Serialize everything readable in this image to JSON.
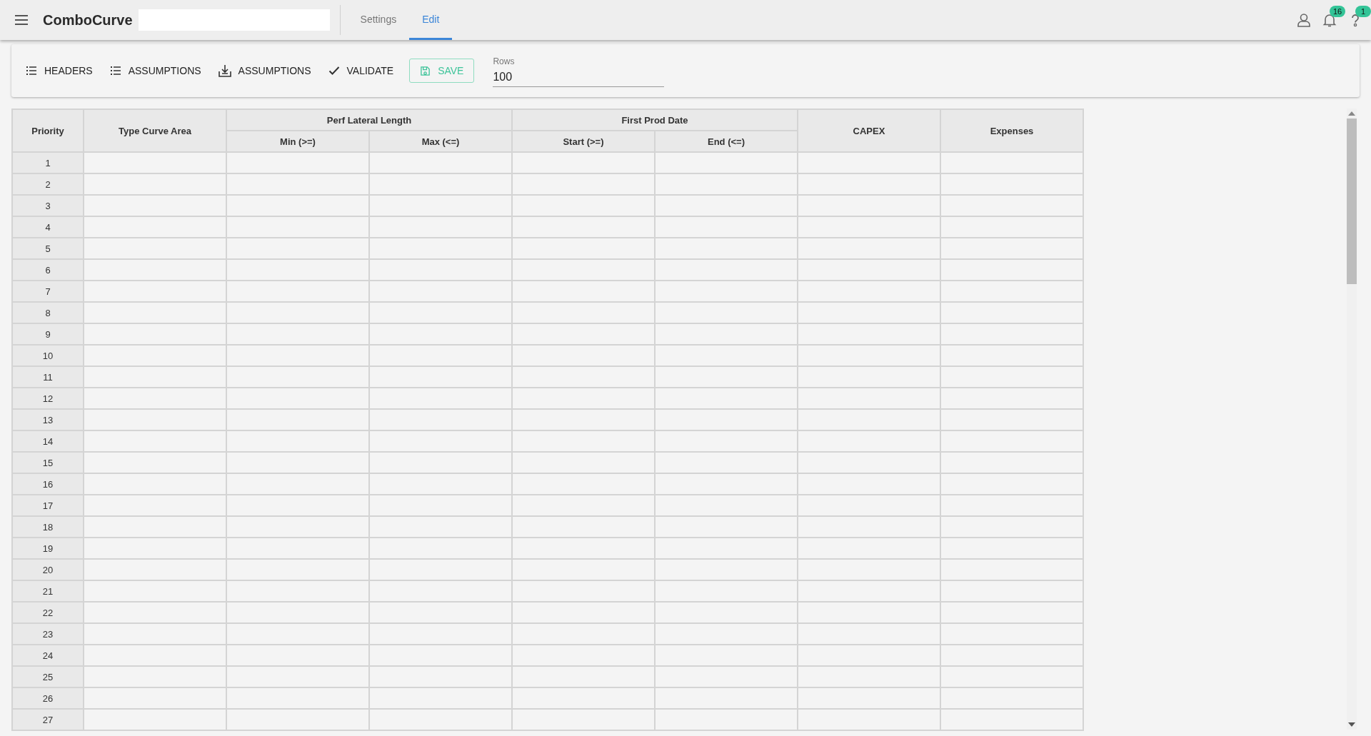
{
  "app": {
    "title": "ComboCurve"
  },
  "tabs": [
    {
      "label": "Settings",
      "selected": false
    },
    {
      "label": "Edit",
      "selected": true
    }
  ],
  "header_icons": [
    {
      "kind": "user"
    },
    {
      "kind": "bell",
      "badge": "16"
    },
    {
      "kind": "help",
      "badge": "1"
    }
  ],
  "toolbar": {
    "buttons": [
      {
        "kind": "list",
        "label": "HEADERS"
      },
      {
        "kind": "list",
        "label": "ASSUMPTIONS"
      },
      {
        "kind": "download",
        "label": "ASSUMPTIONS"
      },
      {
        "kind": "check",
        "label": "VALIDATE"
      },
      {
        "kind": "save",
        "label": "SAVE"
      }
    ],
    "rows_field": {
      "label": "Rows",
      "value": "100"
    }
  },
  "table": {
    "columns": [
      {
        "label": "Priority"
      },
      {
        "label": "Type Curve Area"
      },
      {
        "label": "Perf Lateral Length",
        "children": [
          {
            "label": "Min (>=)"
          },
          {
            "label": "Max (<=)"
          }
        ]
      },
      {
        "label": "First Prod Date",
        "children": [
          {
            "label": "Start (>=)"
          },
          {
            "label": "End (<=)"
          }
        ]
      },
      {
        "label": "CAPEX"
      },
      {
        "label": "Expenses"
      }
    ],
    "rows": [
      "1",
      "2",
      "3",
      "4",
      "5",
      "6",
      "7",
      "8",
      "9",
      "10",
      "11",
      "12",
      "13",
      "14",
      "15",
      "16",
      "17",
      "18",
      "19",
      "20",
      "21",
      "22",
      "23",
      "24",
      "25",
      "26",
      "27"
    ]
  }
}
